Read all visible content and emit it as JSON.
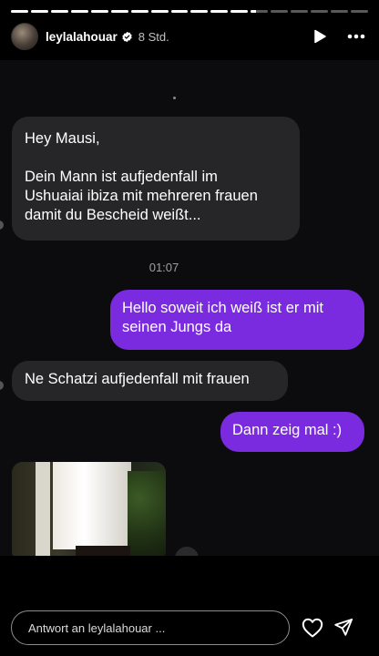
{
  "story": {
    "progress": {
      "segments_total": 18,
      "segments_complete": 12,
      "current_fraction": 0.3
    },
    "header": {
      "username": "leylalahouar",
      "time_ago": "8 Std."
    },
    "chat": {
      "messages": [
        {
          "direction": "incoming",
          "lines": [
            "Hey Mausi,",
            "",
            "Dein Mann ist aufjedenfall im",
            "Ushuaiai ibiza mit mehreren frauen",
            "damit du Bescheid weißt..."
          ]
        },
        {
          "direction": "outgoing",
          "text": "Hello soweit ich weiß ist er mit seinen Jungs da"
        },
        {
          "direction": "incoming",
          "text": "Ne Schatzi aufjedenfall mit frauen"
        },
        {
          "direction": "outgoing",
          "text": "Dann zeig mal :)"
        }
      ],
      "timestamp": "01:07"
    },
    "reply": {
      "placeholder": "Antwort an leylalahouar ..."
    },
    "colors": {
      "outgoing_bubble": "#7a2be0",
      "incoming_bubble": "#262628",
      "background": "#000000"
    }
  }
}
